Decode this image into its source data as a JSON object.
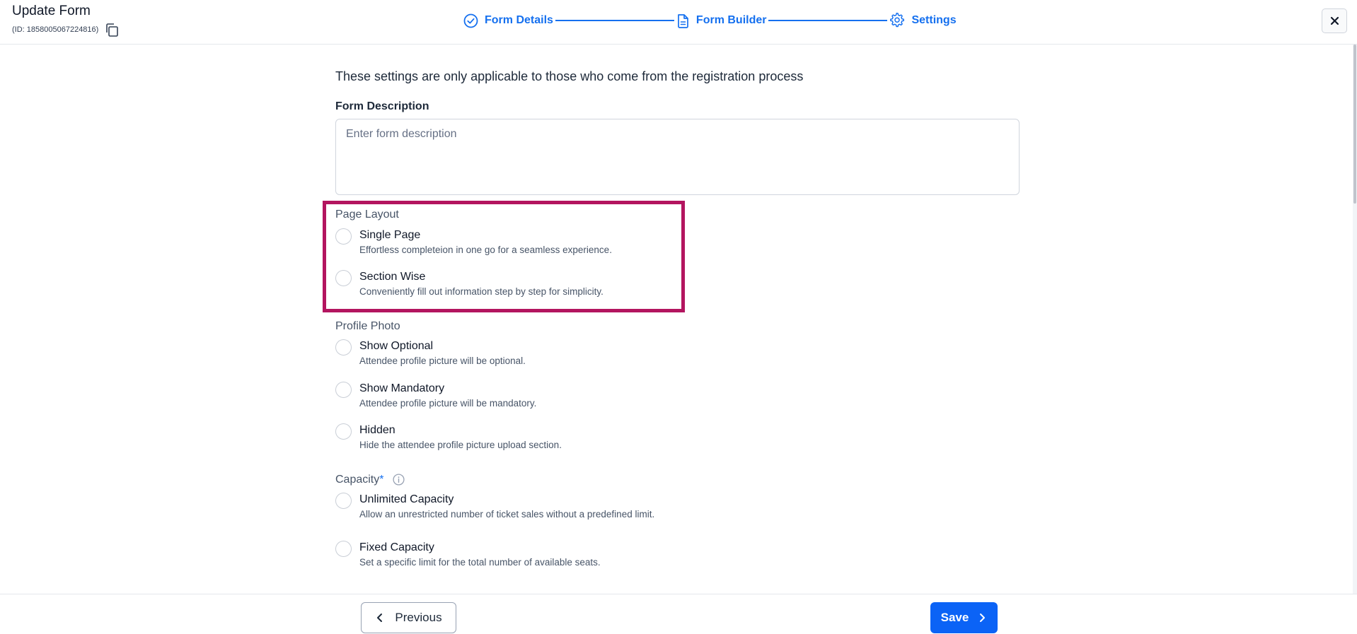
{
  "header": {
    "title": "Update Form",
    "id_text": "(ID: 1858005067224816)"
  },
  "stepper": {
    "steps": [
      {
        "label": "Form Details",
        "icon": "check-circle-icon"
      },
      {
        "label": "Form Builder",
        "icon": "document-icon"
      },
      {
        "label": "Settings",
        "icon": "gear-icon"
      }
    ],
    "accent_color": "#1570ef"
  },
  "main": {
    "intro": "These settings are only applicable to those who come from the registration process",
    "form_description": {
      "label": "Form Description",
      "placeholder": "Enter form description",
      "value": ""
    },
    "page_layout": {
      "label": "Page Layout",
      "options": [
        {
          "title": "Single Page",
          "desc": "Effortless completeion in one go for a seamless experience."
        },
        {
          "title": "Section Wise",
          "desc": "Conveniently fill out information step by step for simplicity."
        }
      ],
      "highlight_color": "#b3155f"
    },
    "profile_photo": {
      "label": "Profile Photo",
      "options": [
        {
          "title": "Show Optional",
          "desc": "Attendee profile picture will be optional."
        },
        {
          "title": "Show Mandatory",
          "desc": "Attendee profile picture will be mandatory."
        },
        {
          "title": "Hidden",
          "desc": "Hide the attendee profile picture upload section."
        }
      ]
    },
    "capacity": {
      "label": "Capacity",
      "required_mark": "*",
      "options": [
        {
          "title": "Unlimited Capacity",
          "desc": "Allow an unrestricted number of ticket sales without a predefined limit."
        },
        {
          "title": "Fixed Capacity",
          "desc": "Set a specific limit for the total number of available seats."
        }
      ]
    }
  },
  "footer": {
    "previous_label": "Previous",
    "save_label": "Save",
    "save_color": "#0b63f6"
  }
}
